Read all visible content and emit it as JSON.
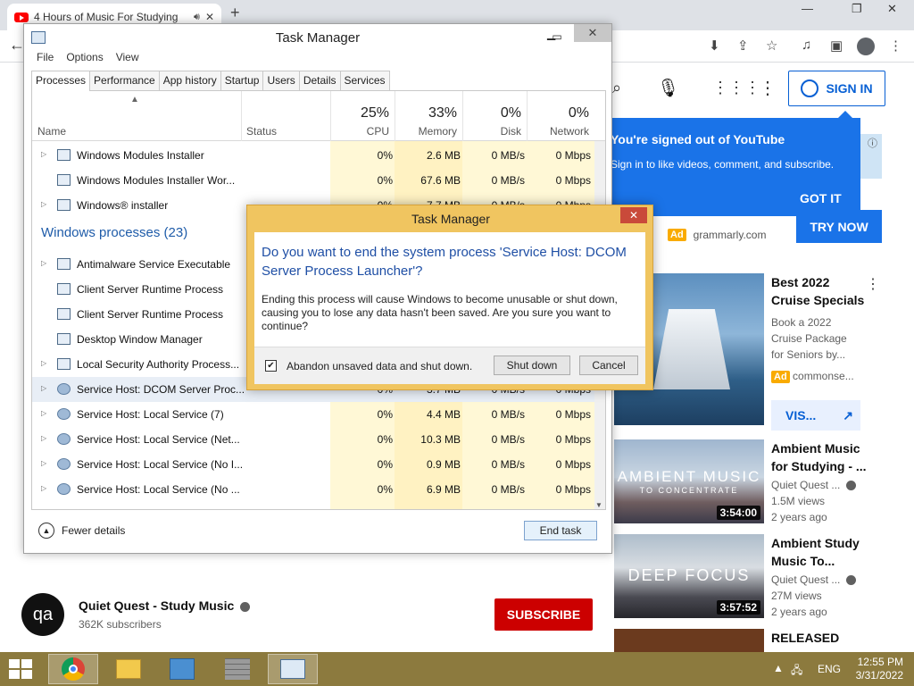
{
  "browser": {
    "tab_title": "4 Hours of Music For Studying",
    "new_tab": "+",
    "window_controls": [
      "⌄",
      "—",
      "❐",
      "✕"
    ],
    "back": "←"
  },
  "youtube": {
    "signin_label": "SIGN IN",
    "tooltip": {
      "title": "You're signed out of YouTube",
      "body": "Sign in to like videos, comment, and subscribe.",
      "button": "GOT IT"
    },
    "ad_top": {
      "cta": "TRY NOW",
      "badge": "Ad",
      "domain": "grammarly.com"
    },
    "ad_cruise": {
      "title": "Best 2022 Cruise Specials",
      "desc": "Book a 2022 Cruise Package for Seniors by...",
      "badge": "Ad",
      "advertiser": "commonse...",
      "visit_label": "VIS..."
    },
    "videos": [
      {
        "title": "Ambient Music for Studying - ...",
        "channel": "Quiet Quest ...",
        "views": "1.5M views",
        "age": "2 years ago",
        "duration": "3:54:00",
        "thumb_text_1": "AMBIENT MUSIC",
        "thumb_text_2": "TO CONCENTRATE"
      },
      {
        "title": "Ambient Study Music To...",
        "channel": "Quiet Quest ...",
        "views": "27M views",
        "age": "2 years ago",
        "duration": "3:57:52",
        "thumb_text_1": "DEEP FOCUS"
      },
      {
        "title": "RELEASED"
      }
    ],
    "channel": {
      "avatar_text": "qa",
      "name": "Quiet Quest - Study Music",
      "subscribers": "362K subscribers",
      "subscribe_label": "SUBSCRIBE"
    }
  },
  "task_manager": {
    "title": "Task Manager",
    "menu": [
      "File",
      "Options",
      "View"
    ],
    "tabs": [
      "Processes",
      "Performance",
      "App history",
      "Startup",
      "Users",
      "Details",
      "Services"
    ],
    "columns": {
      "name": "Name",
      "status": "Status",
      "cpu_pct": "25%",
      "cpu": "CPU",
      "mem_pct": "33%",
      "mem": "Memory",
      "disk_pct": "0%",
      "disk": "Disk",
      "net_pct": "0%",
      "net": "Network"
    },
    "rows_top": [
      {
        "name": "Windows Modules Installer",
        "cpu": "0%",
        "mem": "2.6 MB",
        "disk": "0 MB/s",
        "net": "0 Mbps"
      },
      {
        "name": "Windows Modules Installer Wor...",
        "cpu": "0%",
        "mem": "67.6 MB",
        "disk": "0 MB/s",
        "net": "0 Mbps"
      },
      {
        "name": "Windows® installer",
        "cpu": "0%",
        "mem": "7.7 MB",
        "disk": "0 MB/s",
        "net": "0 Mbps"
      }
    ],
    "group_label": "Windows processes (23)",
    "rows_group": [
      {
        "name": "Antimalware Service Executable"
      },
      {
        "name": "Client Server Runtime Process"
      },
      {
        "name": "Client Server Runtime Process"
      },
      {
        "name": "Desktop Window Manager"
      },
      {
        "name": "Local Security Authority Process..."
      },
      {
        "name": "Service Host: DCOM Server Proc...",
        "cpu": "0%",
        "mem": "3.7 MB",
        "disk": "0 MB/s",
        "net": "0 Mbps"
      },
      {
        "name": "Service Host: Local Service (7)",
        "cpu": "0%",
        "mem": "4.4 MB",
        "disk": "0 MB/s",
        "net": "0 Mbps"
      },
      {
        "name": "Service Host: Local Service (Net...",
        "cpu": "0%",
        "mem": "10.3 MB",
        "disk": "0 MB/s",
        "net": "0 Mbps"
      },
      {
        "name": "Service Host: Local Service (No I...",
        "cpu": "0%",
        "mem": "0.9 MB",
        "disk": "0 MB/s",
        "net": "0 Mbps"
      },
      {
        "name": "Service Host: Local Service (No ...",
        "cpu": "0%",
        "mem": "6.9 MB",
        "disk": "0 MB/s",
        "net": "0 Mbps"
      }
    ],
    "fewer_details": "Fewer details",
    "end_task": "End task"
  },
  "dialog": {
    "title": "Task Manager",
    "heading": "Do you want to end the system process 'Service Host: DCOM Server Process Launcher'?",
    "body": "Ending this process will cause Windows to become unusable or shut down, causing you to lose any data hasn't been saved. Are you sure you want to continue?",
    "checkbox_label": "Abandon unsaved data and shut down.",
    "checkbox_checked": true,
    "shutdown_label": "Shut down",
    "cancel_label": "Cancel"
  },
  "taskbar": {
    "language": "ENG",
    "time": "12:55 PM",
    "date": "3/31/2022"
  }
}
